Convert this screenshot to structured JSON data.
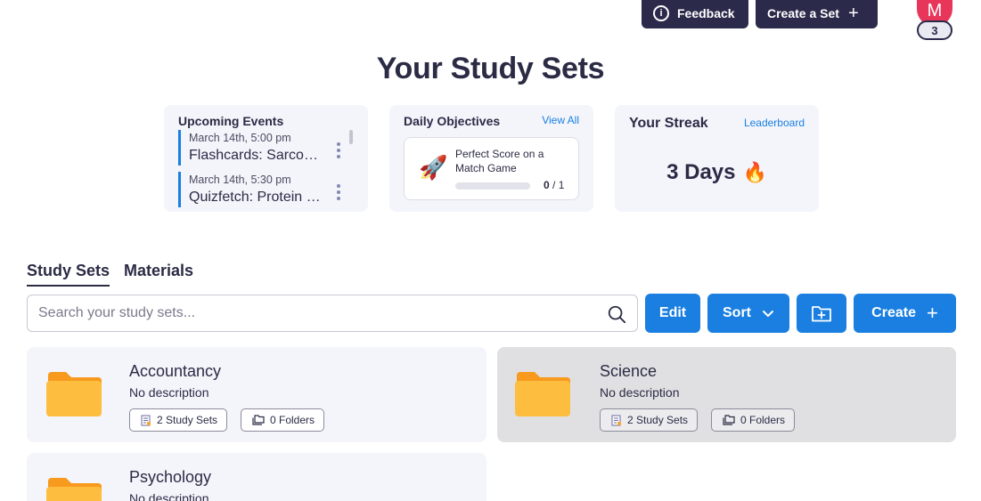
{
  "header": {
    "feedback_label": "Feedback",
    "create_set_label": "Create a Set",
    "avatar_initial": "M",
    "avatar_badge": "3"
  },
  "page": {
    "title": "Your Study Sets"
  },
  "upcoming_events": {
    "title": "Upcoming Events",
    "items": [
      {
        "date": "March 14th, 5:00 pm",
        "name": "Flashcards: Sarcomere Structure"
      },
      {
        "date": "March 14th, 5:30 pm",
        "name": "Quizfetch: Protein Synthesis"
      }
    ]
  },
  "daily_objectives": {
    "title": "Daily Objectives",
    "view_all": "View All",
    "objective": {
      "icon": "rocket-icon",
      "text": "Perfect Score on a Match Game",
      "done": "0",
      "total": " / 1",
      "progress": 0
    }
  },
  "streak": {
    "title": "Your Streak",
    "leaderboard": "Leaderboard",
    "value": "3 Days",
    "icon": "fire-icon"
  },
  "tabs": [
    {
      "label": "Study Sets",
      "active": true
    },
    {
      "label": "Materials",
      "active": false
    }
  ],
  "search": {
    "placeholder": "Search your study sets...",
    "value": ""
  },
  "toolbar": {
    "edit_label": "Edit",
    "sort_label": "Sort",
    "create_label": "Create"
  },
  "folders": [
    {
      "name": "Accountancy",
      "description": "No description",
      "study_sets": "2 Study Sets",
      "folders": "0 Folders"
    },
    {
      "name": "Science",
      "description": "No description",
      "study_sets": "2 Study Sets",
      "folders": "0 Folders"
    },
    {
      "name": "Psychology",
      "description": "No description"
    }
  ],
  "colors": {
    "primary": "#1a7fe0",
    "dark": "#2c2a4a",
    "avatar": "#e8365b",
    "folder": "#fdbd3f"
  }
}
